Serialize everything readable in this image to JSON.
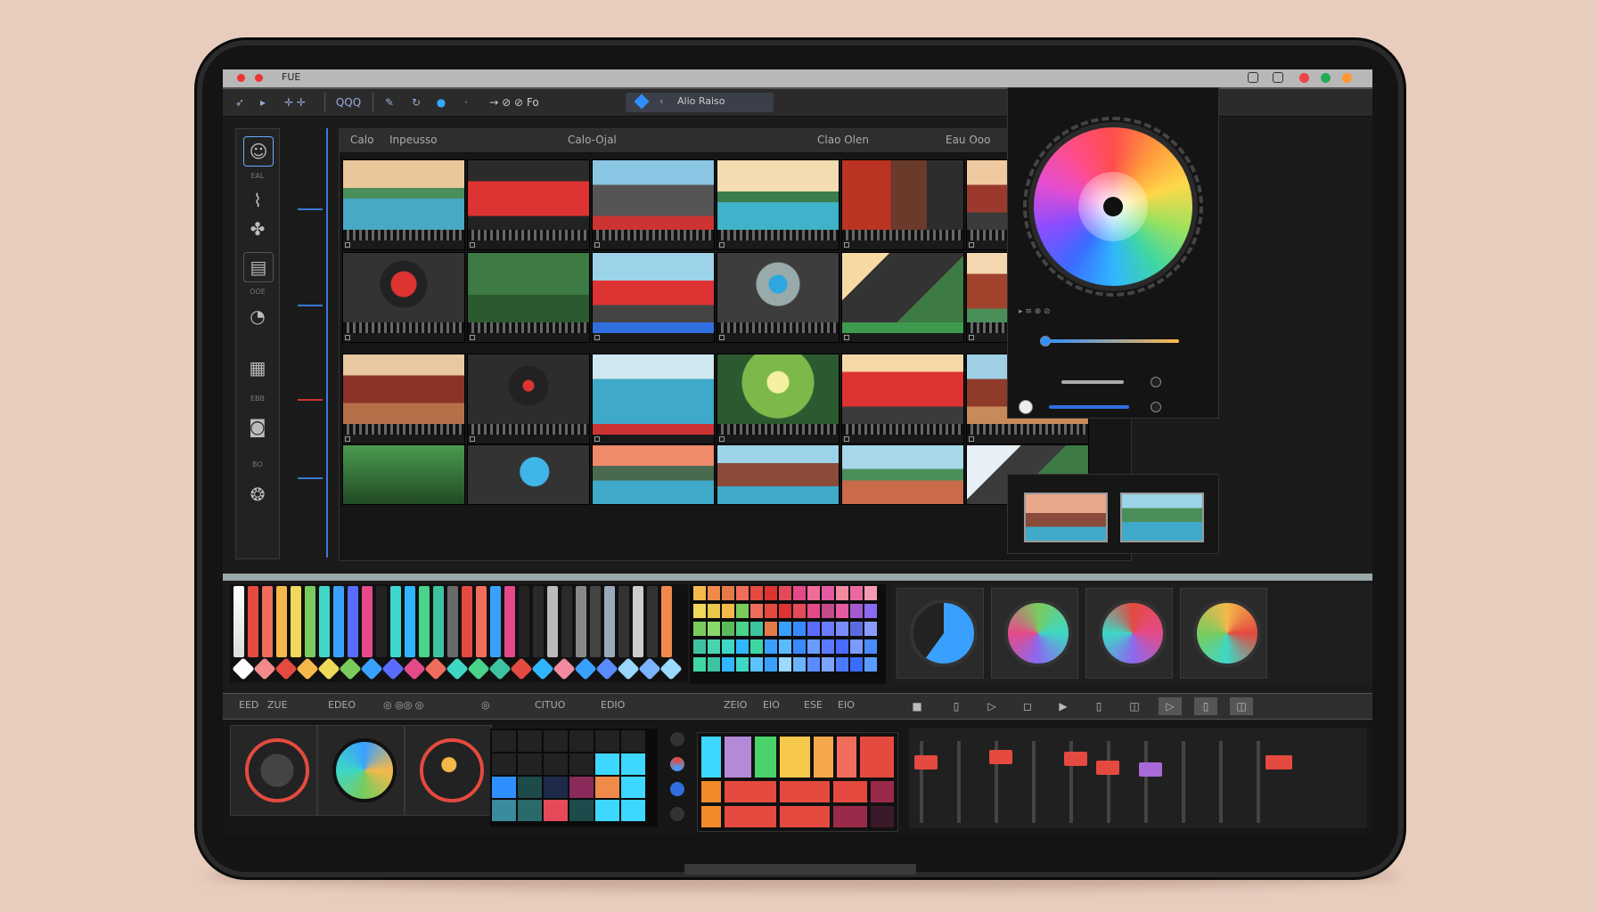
{
  "window": {
    "title": "FUE"
  },
  "toolbar": {
    "group1": "QQQ",
    "search_value": "Alio Raiso",
    "tool_a": "→ ⊘ ⊘ Fo"
  },
  "browser": {
    "header": {
      "col1": "Calo",
      "col2": "Inpeusso",
      "col3": "Calo-Ojal",
      "col4": "Clao Olen",
      "col5": "Eau Ooo"
    }
  },
  "sidebar": {
    "labels": [
      "EAL",
      "OOE",
      "EBB",
      "BO"
    ]
  },
  "tabbar": {
    "labels": [
      "EED",
      "ZUE",
      "EDEO",
      "CITUO",
      "EDIO",
      "ZEIO",
      "EIO",
      "ESE",
      "EIO"
    ]
  },
  "colors": {
    "accent": "#3a7bd5",
    "highlight": "#2f8fff",
    "red": "#e44a3f"
  },
  "icons": [
    "settings-icon",
    "pen-icon",
    "brush-icon",
    "grid-icon",
    "camera-icon",
    "globe-icon",
    "play-icon",
    "stop-icon"
  ]
}
